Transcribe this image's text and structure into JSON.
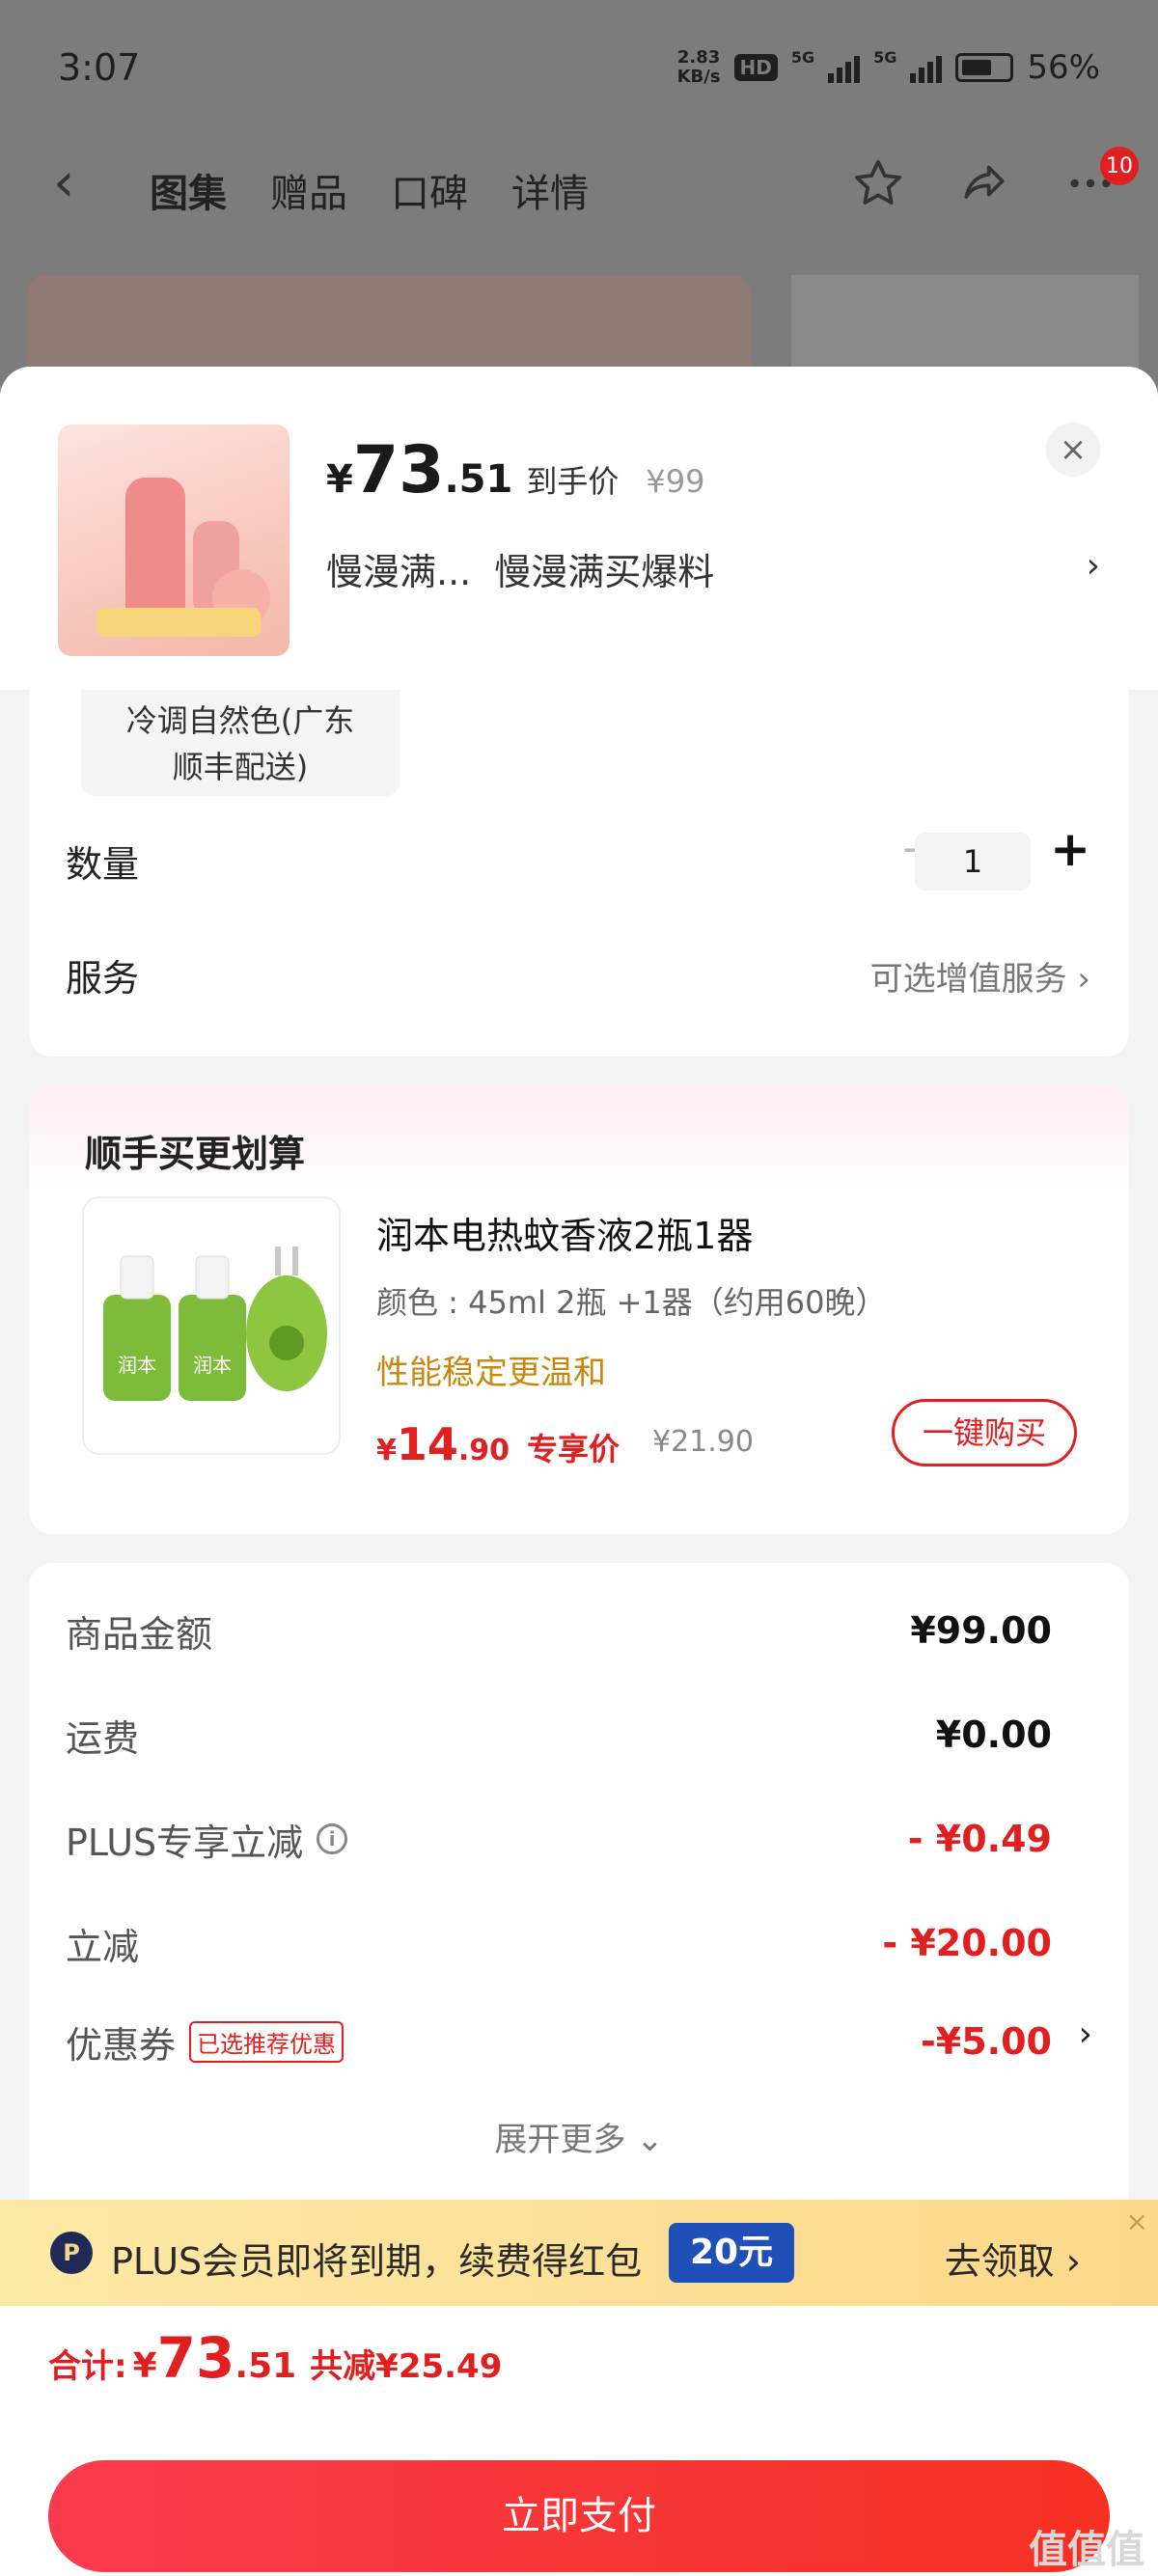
{
  "status": {
    "time": "3:07",
    "net_speed": "2.83",
    "net_unit": "KB/s",
    "hd": "HD",
    "sim1": "5G",
    "sim2": "5G",
    "battery": "56%"
  },
  "nav": {
    "tabs": [
      {
        "label": "图集"
      },
      {
        "label": "赠品"
      },
      {
        "label": "口碑"
      },
      {
        "label": "详情"
      }
    ],
    "active_tab": "图集",
    "badge": "10",
    "icons": [
      "star-icon",
      "share-icon",
      "more-icon"
    ]
  },
  "sheet": {
    "price_yen": "¥",
    "price_int": "73",
    "price_dec": ".51",
    "price_note": "到手价",
    "price_orig": "¥99",
    "title_part1": "慢漫满...",
    "title_part2": "慢漫满买爆料",
    "close": "×",
    "chevron": "›"
  },
  "spec": {
    "selected_line1": "冷调自然色(广东",
    "selected_line2": "顺丰配送)",
    "qty_label": "数量",
    "qty_minus": "−",
    "qty_value": "1",
    "qty_plus": "+",
    "svc_label": "服务",
    "svc_value": "可选增值服务 ›"
  },
  "combo": {
    "title": "顺手买更划算",
    "name": "润本电热蚊香液2瓶1器",
    "spec": "颜色 : 45ml 2瓶 +1器（约用60晚）",
    "tag": "性能稳定更温和",
    "price_yen": "¥",
    "price_int": "14",
    "price_dec": ".90",
    "price_note": "专享价",
    "price_orig": "¥21.90",
    "buy_label": "一键购买",
    "product_brand": "润本"
  },
  "summary": {
    "rows": [
      {
        "label": "商品金额",
        "value": "¥99.00"
      },
      {
        "label": "运费",
        "value": "¥0.00"
      },
      {
        "label": "PLUS专享立减",
        "value": "- ¥0.49"
      },
      {
        "label": "立减",
        "value": "- ¥20.00"
      },
      {
        "label": "优惠券",
        "value": "-¥5.00"
      }
    ],
    "coupon_tag": "已选推荐优惠",
    "info_glyph": "i",
    "expand": "展开更多 ⌄"
  },
  "plus": {
    "logo": "P",
    "text": "PLUS会员即将到期，续费得红包",
    "amount": "20元",
    "action": "去领取 ›",
    "close": "×"
  },
  "footer": {
    "total_label": "合计:",
    "total_yen": "¥",
    "total_int": "73",
    "total_dec": ".51",
    "saved": "共减¥25.49",
    "pay_label": "立即支付",
    "watermark": "值值值"
  },
  "colors": {
    "accent": "#e02020",
    "pay_gradient_start": "#f83b4d",
    "pay_gradient_end": "#f63022",
    "plus_blue": "#1f4fb8",
    "tag_gold": "#c8870f"
  }
}
